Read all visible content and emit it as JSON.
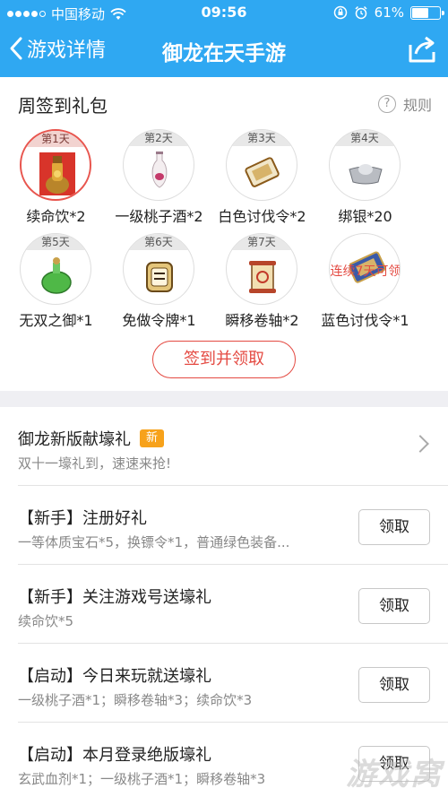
{
  "status_bar": {
    "carrier": "中国移动",
    "time": "09:56",
    "battery": "61%",
    "battery_level": 0.61
  },
  "nav": {
    "back_label": "游戏详情",
    "title": "御龙在天手游"
  },
  "signin": {
    "title": "周签到礼包",
    "rules_label": "规则",
    "button_label": "签到并领取",
    "days": [
      {
        "day": "第1天",
        "label": "续命饮*2",
        "icon": "potion-gold-icon",
        "active": true
      },
      {
        "day": "第2天",
        "label": "一级桃子酒*2",
        "icon": "wine-vase-icon"
      },
      {
        "day": "第3天",
        "label": "白色讨伐令*2",
        "icon": "scroll-token-white-icon"
      },
      {
        "day": "第4天",
        "label": "绑银*20",
        "icon": "silver-ingot-icon"
      },
      {
        "day": "第5天",
        "label": "无双之御*1",
        "icon": "green-potion-icon"
      },
      {
        "day": "第6天",
        "label": "免做令牌*1",
        "icon": "exempt-token-icon"
      },
      {
        "day": "第7天",
        "label": "瞬移卷轴*2",
        "icon": "teleport-scroll-icon"
      },
      {
        "day": "",
        "label": "蓝色讨伐令*1",
        "icon": "scroll-token-blue-icon",
        "overlay": "连续7天可领"
      }
    ]
  },
  "list": {
    "items": [
      {
        "title": "御龙新版献壕礼",
        "badge": "新",
        "subtitle": "双十一壕礼到，速速来抢!",
        "action": "chevron"
      },
      {
        "title": "【新手】注册好礼",
        "subtitle": "一等体质宝石*5，换镖令*1，普通绿色装备...",
        "action": "领取"
      },
      {
        "title": "【新手】关注游戏号送壕礼",
        "subtitle": "续命饮*5",
        "action": "领取"
      },
      {
        "title": "【启动】今日来玩就送壕礼",
        "subtitle": "一级桃子酒*1；瞬移卷轴*3；续命饮*3",
        "action": "领取"
      },
      {
        "title": "【启动】本月登录绝版壕礼",
        "subtitle": "玄武血剂*1；一级桃子酒*1；瞬移卷轴*3",
        "action": "领取"
      }
    ]
  },
  "watermark": "游戏窝",
  "colors": {
    "header": "#2fa8f2",
    "accent_red": "#e44a42",
    "badge_orange": "#f7a21b"
  }
}
